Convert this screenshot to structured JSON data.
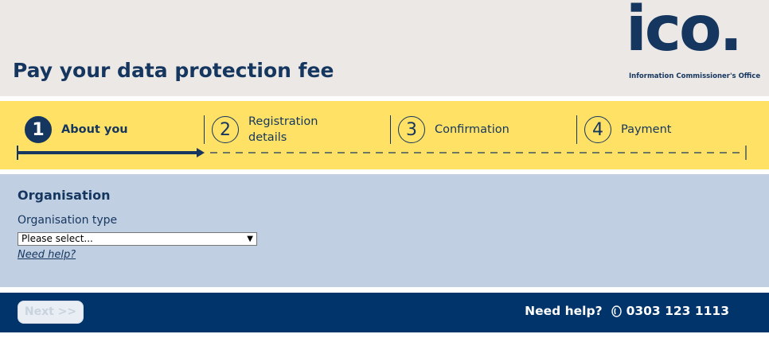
{
  "header": {
    "title": "Pay your data protection fee",
    "logo": {
      "text": "ico.",
      "subtitle": "Information Commissioner's Office"
    }
  },
  "steps": [
    {
      "number": "1",
      "label": "About you",
      "active": true
    },
    {
      "number": "2",
      "label_line1": "Registration",
      "label_line2": "details",
      "active": false
    },
    {
      "number": "3",
      "label": "Confirmation",
      "active": false
    },
    {
      "number": "4",
      "label": "Payment",
      "active": false
    }
  ],
  "form": {
    "section_title": "Organisation",
    "organisation_type_label": "Organisation type",
    "organisation_type_value": "Please select...",
    "help_link": "Need help?"
  },
  "footer": {
    "next_label": "Next >>",
    "help_text": "Need help?",
    "phone": "0303 123 1113"
  },
  "colors": {
    "brand_navy": "#15365f",
    "header_bg": "#ece8e5",
    "steps_bg": "#fee165",
    "form_bg": "#c1cfe3",
    "footer_bg": "#01346a"
  }
}
